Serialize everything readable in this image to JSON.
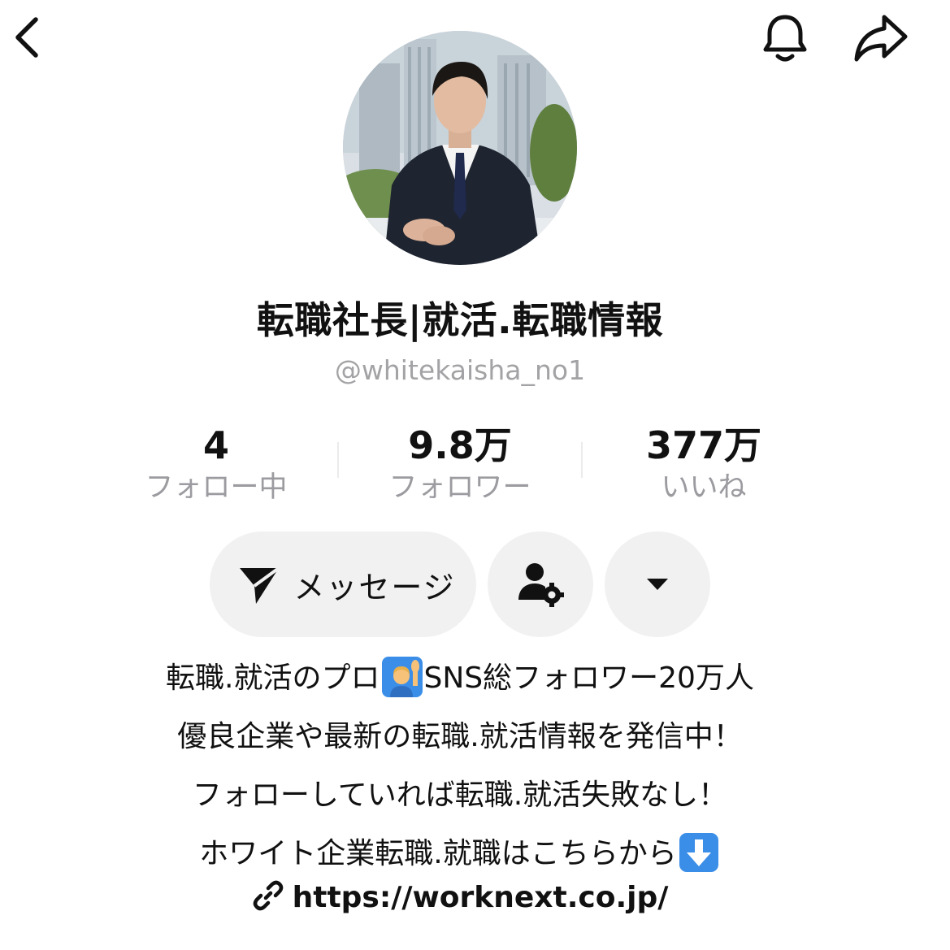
{
  "header": {
    "back_icon": "chevron-left-icon",
    "notification_icon": "bell-icon",
    "share_icon": "share-arrow-icon"
  },
  "profile": {
    "avatar": "avatar-photo",
    "display_name": "転職社長|就活.転職情報",
    "handle": "@whitekaisha_no1"
  },
  "stats": {
    "following": {
      "value": "4",
      "label": "フォロー中"
    },
    "followers": {
      "value": "9.8万",
      "label": "フォロワー"
    },
    "likes": {
      "value": "377万",
      "label": "いいね"
    }
  },
  "actions": {
    "message_label": "メッセージ",
    "message_icon": "send-icon",
    "profile_settings_icon": "person-gear-icon",
    "more_icon": "caret-down-icon"
  },
  "bio": {
    "line1_prefix": "転職.就活のプロ",
    "line1_emoji": "raising-hand-emoji",
    "line1_suffix": "SNS総フォロワー20万人",
    "line2": "優良企業や最新の転職.就活情報を発信中！",
    "line3": "フォローしていれば転職.就活失敗なし！",
    "line4_text": "ホワイト企業転職.就職はこちらから",
    "line4_emoji": "down-arrow-emoji",
    "link_icon": "link-icon",
    "link": "https://worknext.co.jp/"
  },
  "colors": {
    "text_primary": "#111111",
    "text_secondary": "#a3a3a6",
    "button_bg": "#f1f1f2",
    "emoji_blue": "#3b8ee8"
  }
}
